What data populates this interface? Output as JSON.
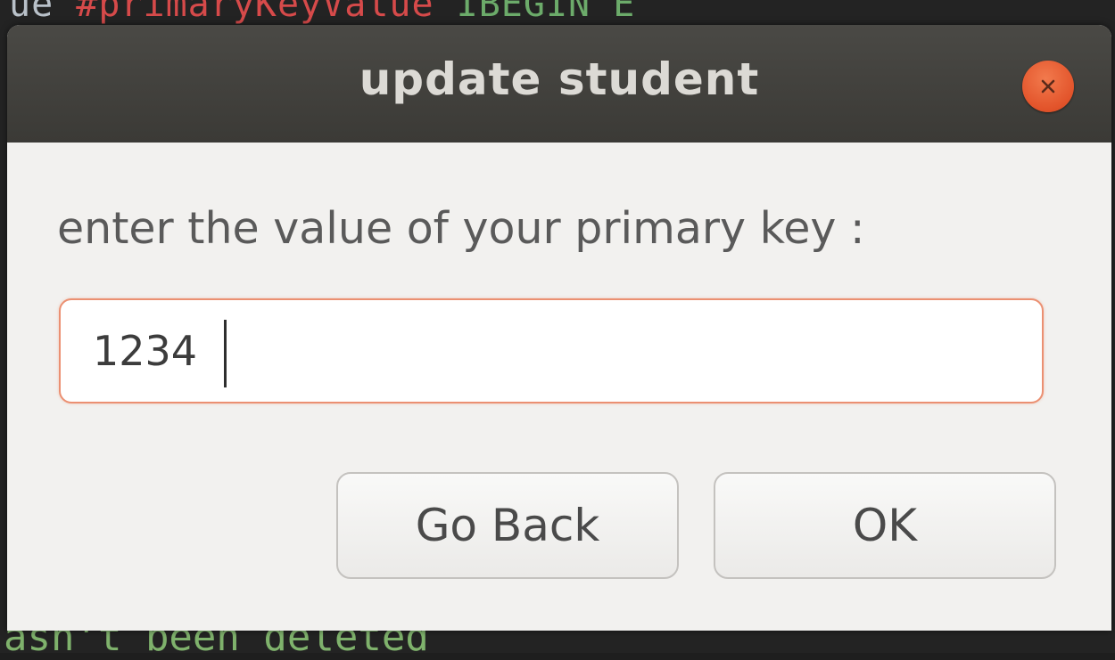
{
  "background_terminal": {
    "top_line": [
      "ue ",
      "#primaryKeyValue",
      " IBEGIN E"
    ],
    "bottom_line": "asn't been deleted"
  },
  "dialog": {
    "title": "update student",
    "close_icon": "close-icon",
    "prompt": "enter the value of your primary key :",
    "primary_key_input": {
      "value": "1234",
      "placeholder": ""
    },
    "buttons": {
      "go_back": "Go Back",
      "ok": "OK"
    }
  },
  "colors": {
    "titlebar": "#3b3a36",
    "close_button": "#e2532a",
    "focus_border": "#eb9072",
    "dialog_bg": "#f2f1ef"
  }
}
